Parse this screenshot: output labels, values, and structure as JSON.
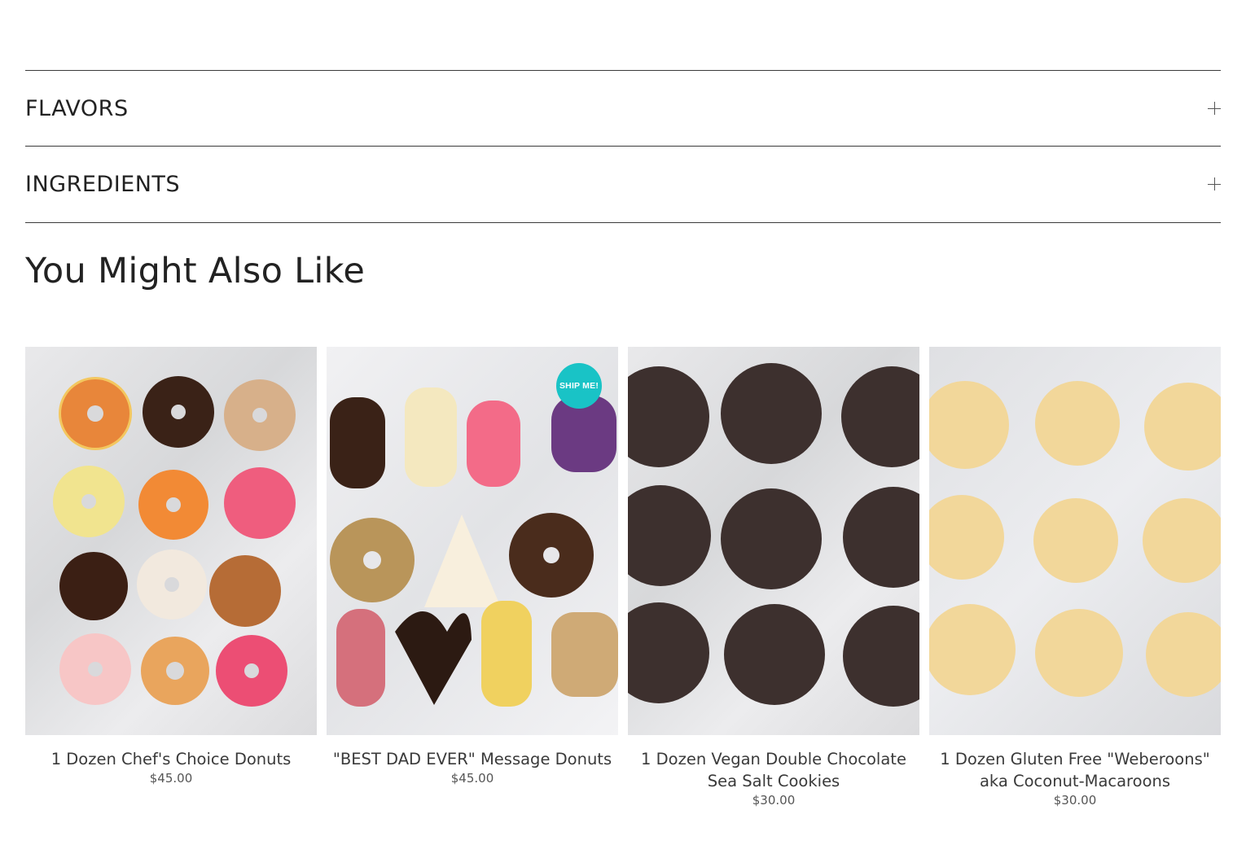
{
  "accordions": [
    {
      "label": "FLAVORS"
    },
    {
      "label": "INGREDIENTS"
    }
  ],
  "related": {
    "title": "You Might Also Like",
    "products": [
      {
        "title": "1 Dozen Chef's Choice Donuts",
        "price": "$45.00",
        "image": "donut-assortment-photo"
      },
      {
        "title": "\"BEST DAD EVER\" Message Donuts",
        "price": "$45.00",
        "image": "letter-donuts-photo",
        "badge": "SHIP ME!"
      },
      {
        "title": "1 Dozen Vegan Double Chocolate Sea Salt Cookies",
        "price": "$30.00",
        "image": "chocolate-cookies-photo"
      },
      {
        "title": "1 Dozen Gluten Free \"Weberoons\" aka Coconut-Macaroons",
        "price": "$30.00",
        "image": "coconut-macaroons-photo"
      }
    ]
  },
  "colors": {
    "badge": "#19c3c6",
    "divider": "#3a3a3a",
    "text": "#2b2b2b"
  }
}
